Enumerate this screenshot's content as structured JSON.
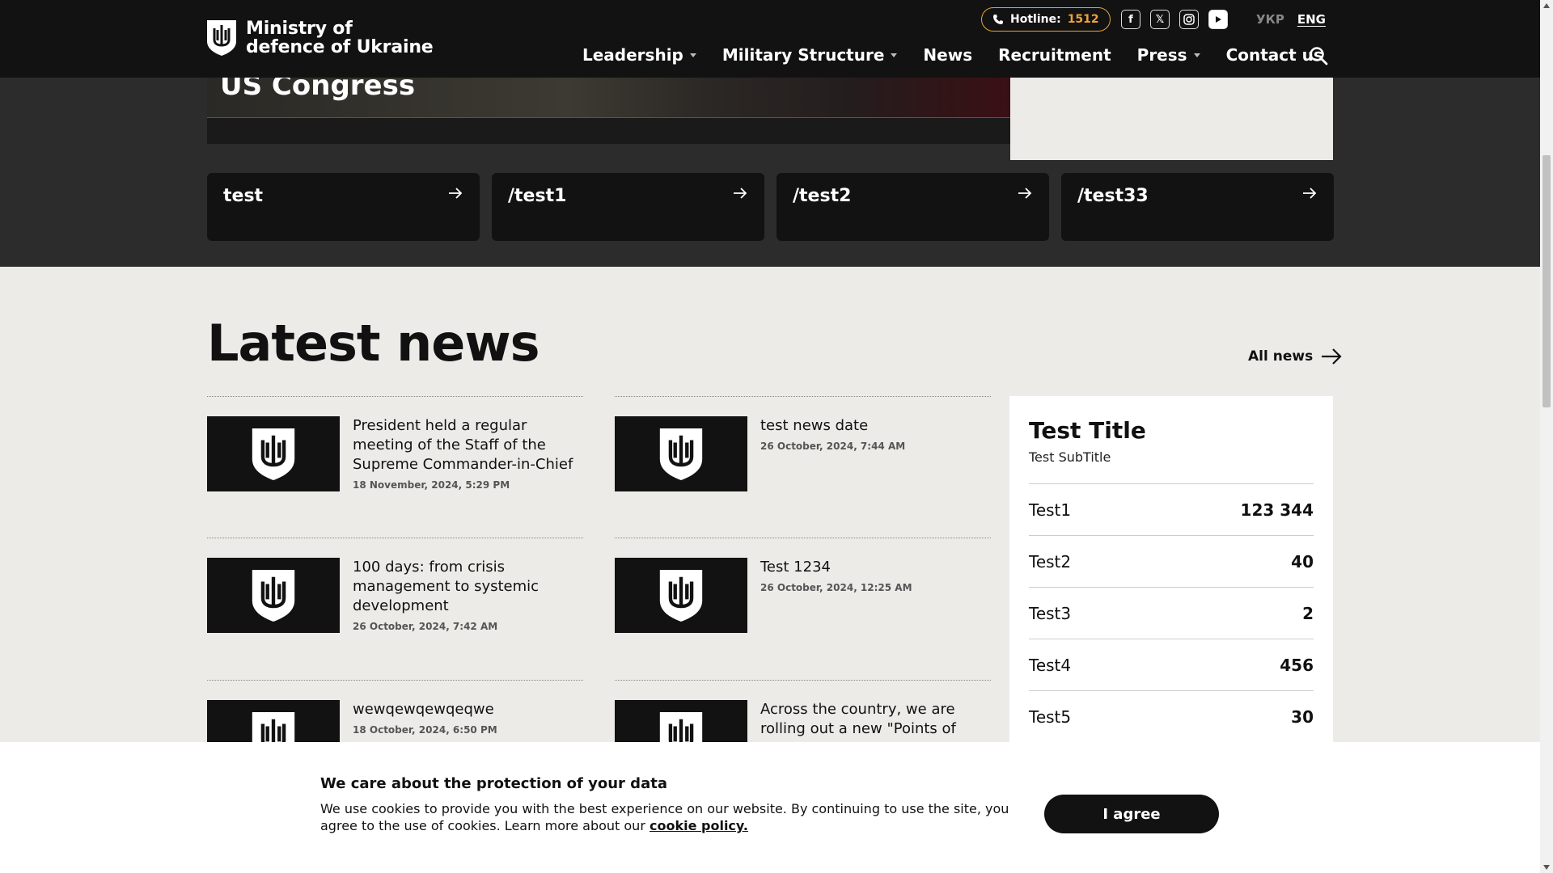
{
  "header": {
    "logo_line1": "Ministry of",
    "logo_line2": "defence of Ukraine",
    "hotline_label": "Hotline:",
    "hotline_number": "1512",
    "social_icons": [
      "facebook-icon",
      "x-twitter-icon",
      "instagram-icon",
      "youtube-icon"
    ],
    "languages": [
      {
        "label": "УКР",
        "active": false
      },
      {
        "label": "ENG",
        "active": true
      }
    ],
    "nav": [
      {
        "label": "Leadership",
        "dropdown": true
      },
      {
        "label": "Military Structure",
        "dropdown": true
      },
      {
        "label": "News",
        "dropdown": false
      },
      {
        "label": "Recruitment",
        "dropdown": false
      },
      {
        "label": "Press",
        "dropdown": true
      },
      {
        "label": "Contact us",
        "dropdown": false
      }
    ]
  },
  "hero": {
    "title_fragment": "US Congress"
  },
  "quick_links": [
    "test",
    "/test1",
    "/test2",
    "/test33"
  ],
  "latest_news": {
    "title": "Latest news",
    "all_news_label": "All news",
    "items": [
      {
        "title": "President held a regular meeting of the Staff of the Supreme Commander-in-Chief",
        "date": "18 November, 2024, 5:29 PM"
      },
      {
        "title": "test news date",
        "date": "26 October, 2024, 7:44 AM"
      },
      {
        "title": "100 days: from crisis management to systemic development",
        "date": "26 October, 2024, 7:42 AM"
      },
      {
        "title": "Test 1234",
        "date": "26 October, 2024, 12:25 AM"
      },
      {
        "title": "wewqewqewqeqwe",
        "date": "18 October, 2024, 6:50 PM"
      },
      {
        "title": "Across the country, we are rolling out a new \"Points of",
        "date": ""
      }
    ]
  },
  "stats": {
    "title": "Test Title",
    "subtitle": "Test SubTitle",
    "rows": [
      {
        "label": "Test1",
        "value": "123 344"
      },
      {
        "label": "Test2",
        "value": "40"
      },
      {
        "label": "Test3",
        "value": "2"
      },
      {
        "label": "Test4",
        "value": "456"
      },
      {
        "label": "Test5",
        "value": "30"
      }
    ]
  },
  "cookie": {
    "title": "We care about the protection of your data",
    "text": "We use cookies to provide you with the best experience on our website. By continuing to use the site, you agree to the use of cookies. Learn more about our",
    "link_label": "cookie policy.",
    "button_label": "I agree"
  },
  "colors": {
    "header_bg": "#121212",
    "hero_bg": "#2c2c2c",
    "page_bg": "#ecebe7",
    "hotline_accent": "#f0a23a"
  }
}
